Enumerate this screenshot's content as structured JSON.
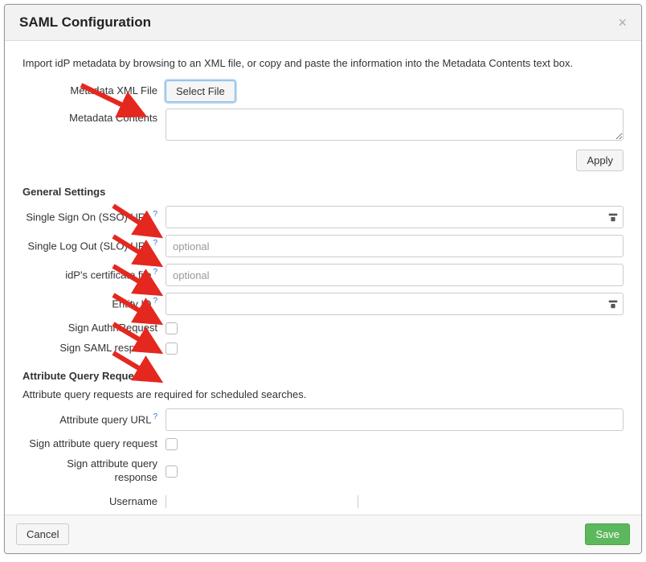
{
  "dialog": {
    "title": "SAML Configuration",
    "intro": "Import idP metadata by browsing to an XML file, or copy and paste the information into the Metadata Contents text box.",
    "metadata_xml_label": "Metadata XML File",
    "select_file_label": "Select File",
    "metadata_contents_label": "Metadata Contents",
    "apply_label": "Apply"
  },
  "general": {
    "section_title": "General Settings",
    "sso_label": "Single Sign On (SSO) URL",
    "slo_label": "Single Log Out (SLO) URL",
    "slo_placeholder": "optional",
    "cert_label": "idP's certificate file",
    "cert_placeholder": "optional",
    "entity_label": "Entity ID",
    "sign_authn_label": "Sign AuthnRequest",
    "sign_saml_label": "Sign SAML response"
  },
  "attrq": {
    "section_title": "Attribute Query Requests",
    "section_sub": "Attribute query requests are required for scheduled searches.",
    "url_label": "Attribute query URL",
    "sign_req_label": "Sign attribute query request",
    "sign_resp_label": "Sign attribute query response",
    "username_label": "Username"
  },
  "footer": {
    "cancel_label": "Cancel",
    "save_label": "Save"
  }
}
